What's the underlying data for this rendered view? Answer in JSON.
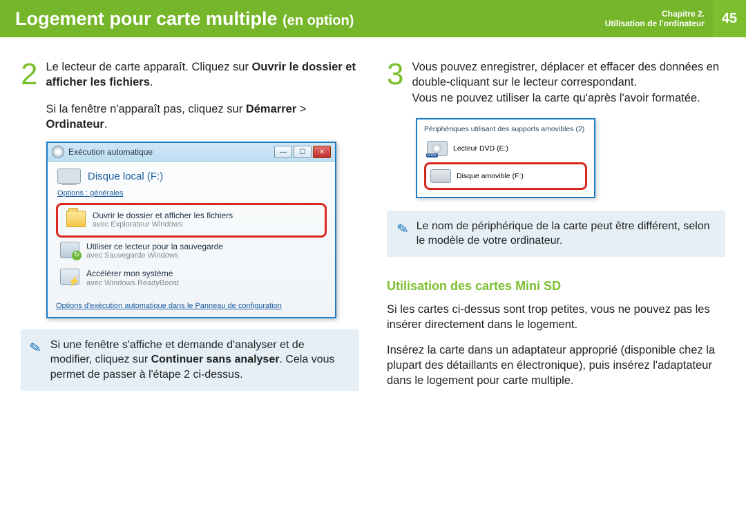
{
  "header": {
    "title_main": "Logement pour carte multiple",
    "title_opt": "(en option)",
    "chapter_line1": "Chapitre 2.",
    "chapter_line2": "Utilisation de l'ordinateur",
    "page_num": "45"
  },
  "left": {
    "step2_num": "2",
    "step2_text_a": "Le lecteur de carte apparaît. Cliquez sur ",
    "step2_text_b": "Ouvrir le dossier et afficher les fichiers",
    "step2_text_c": ".",
    "sub_a": "Si la fenêtre n'apparaît pas, cliquez sur ",
    "sub_b1": "Démarrer",
    "sub_sep": " > ",
    "sub_b2": "Ordinateur",
    "sub_c": ".",
    "autoplay": {
      "title": "Exécution automatique",
      "drive_label": "Disque local (F:)",
      "section_general": "Options : générales",
      "item_open_title": "Ouvrir le dossier et afficher les fichiers",
      "item_open_sub": "avec Explorateur Windows",
      "item_backup_title": "Utiliser ce lecteur pour la sauvegarde",
      "item_backup_sub": "avec Sauvegarde Windows",
      "item_boost_title": "Accélérer mon système",
      "item_boost_sub": "avec Windows ReadyBoost",
      "footer_link": "Options d'exécution automatique dans le Panneau de configuration"
    },
    "note_a": "Si une fenêtre s'affiche et demande d'analyser et de modifier, cliquez sur ",
    "note_b": "Continuer sans analyser",
    "note_c": ". Cela vous permet de passer à l'étape 2 ci-dessus."
  },
  "right": {
    "step3_num": "3",
    "step3_line1": "Vous pouvez enregistrer, déplacer et effacer des données en double-cliquant sur le lecteur correspondant.",
    "step3_line2": "Vous ne pouvez utiliser la carte qu'après l'avoir formatée.",
    "devwin": {
      "title": "Périphériques utilisant des supports amovibles (2)",
      "dvd_badge": "DVD",
      "dvd_label": "Lecteur DVD (E:)",
      "removable_label": "Disque amovible (F:)"
    },
    "note": "Le nom de périphérique de la carte peut être différent, selon le modèle de votre ordinateur.",
    "subheading": "Utilisation des cartes Mini SD",
    "p1": "Si les cartes ci-dessus sont trop petites, vous ne pouvez pas les insérer directement dans le logement.",
    "p2": "Insérez la carte dans un adaptateur approprié (disponible chez la plupart des détaillants en électronique), puis insérez l'adaptateur dans le logement pour carte multiple."
  }
}
